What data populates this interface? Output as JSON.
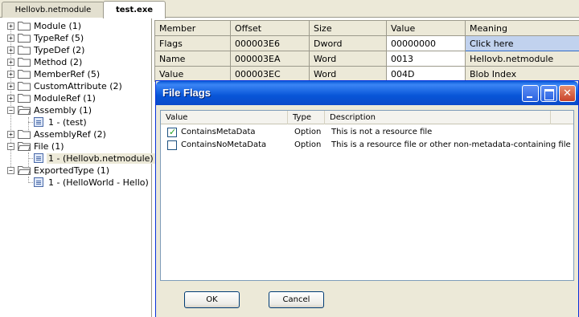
{
  "tabs": [
    {
      "label": "Hellovb.netmodule",
      "active": false
    },
    {
      "label": "test.exe",
      "active": true
    }
  ],
  "tree": [
    {
      "label": "Module (1)",
      "expander": "+"
    },
    {
      "label": "TypeRef (5)",
      "expander": "+"
    },
    {
      "label": "TypeDef (2)",
      "expander": "+"
    },
    {
      "label": "Method (2)",
      "expander": "+"
    },
    {
      "label": "MemberRef (5)",
      "expander": "+"
    },
    {
      "label": "CustomAttribute (2)",
      "expander": "+"
    },
    {
      "label": "ModuleRef (1)",
      "expander": "+"
    },
    {
      "label": "Assembly (1)",
      "expander": "−"
    },
    {
      "label": "1 - (test)",
      "child": true
    },
    {
      "label": "AssemblyRef (2)",
      "expander": "+"
    },
    {
      "label": "File (1)",
      "expander": "−"
    },
    {
      "label": "1 - (Hellovb.netmodule)",
      "child": true,
      "selected": true
    },
    {
      "label": "ExportedType (1)",
      "expander": "−"
    },
    {
      "label": "1 - (HelloWorld - Hello)",
      "child": true
    }
  ],
  "grid": {
    "headers": [
      "Member",
      "Offset",
      "Size",
      "Value",
      "Meaning"
    ],
    "rows": [
      [
        "Flags",
        "000003E6",
        "Dword",
        "00000000",
        "Click here"
      ],
      [
        "Name",
        "000003EA",
        "Word",
        "0013",
        "Hellovb.netmodule"
      ],
      [
        "Value",
        "000003EC",
        "Word",
        "004D",
        "Blob Index"
      ]
    ]
  },
  "dialog": {
    "title": "File Flags",
    "columns": [
      "Value",
      "Type",
      "Description"
    ],
    "rows": [
      {
        "checked": true,
        "value": "ContainsMetaData",
        "type": "Option",
        "description": "This is not a resource file"
      },
      {
        "checked": false,
        "value": "ContainsNoMetaData",
        "type": "Option",
        "description": "This is a resource file or other non-metadata-containing file"
      }
    ],
    "ok_label": "OK",
    "cancel_label": "Cancel"
  },
  "colors": {
    "titlebar": "#0a5ad8",
    "selection": "#c1d2ee",
    "panel": "#ece9d8"
  }
}
